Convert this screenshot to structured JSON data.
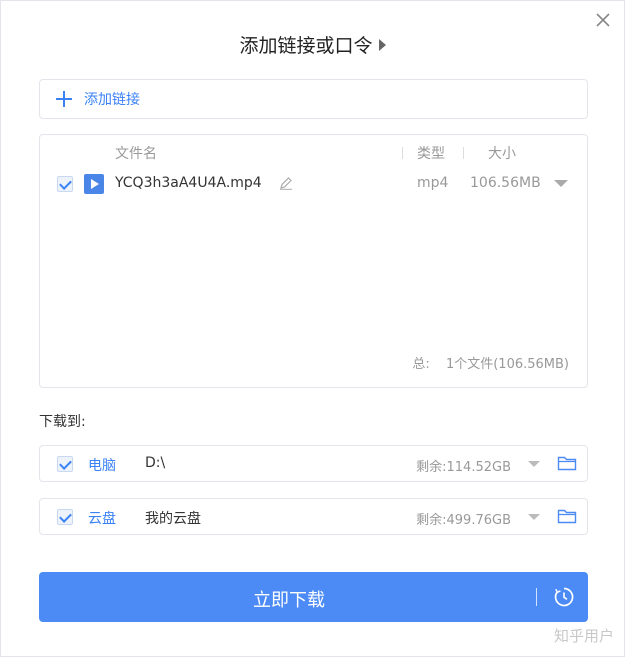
{
  "dialog": {
    "title": "添加链接或口令",
    "close_icon": "close-icon"
  },
  "add_link": {
    "label": "添加链接",
    "icon": "plus-icon"
  },
  "file_table": {
    "headers": {
      "name": "文件名",
      "type": "类型",
      "size": "大小"
    },
    "files": [
      {
        "checked": true,
        "icon": "video-icon",
        "name": "YCQ3h3aA4U4A.mp4",
        "type": "mp4",
        "size": "106.56MB"
      }
    ],
    "summary_label": "总:",
    "summary_value": "1个文件(106.56MB)"
  },
  "download_to": {
    "label": "下载到:",
    "targets": [
      {
        "checked": true,
        "name": "电脑",
        "path": "D:\\",
        "free": "剩余:114.52GB",
        "icon": "folder-icon"
      },
      {
        "checked": true,
        "name": "云盘",
        "path": "我的云盘",
        "free": "剩余:499.76GB",
        "icon": "folder-icon"
      }
    ]
  },
  "download_button": {
    "label": "立即下载",
    "icon": "clock-icon"
  },
  "watermark": "知乎用户",
  "colors": {
    "accent": "#4c8bf5",
    "link": "#3b82f6"
  }
}
